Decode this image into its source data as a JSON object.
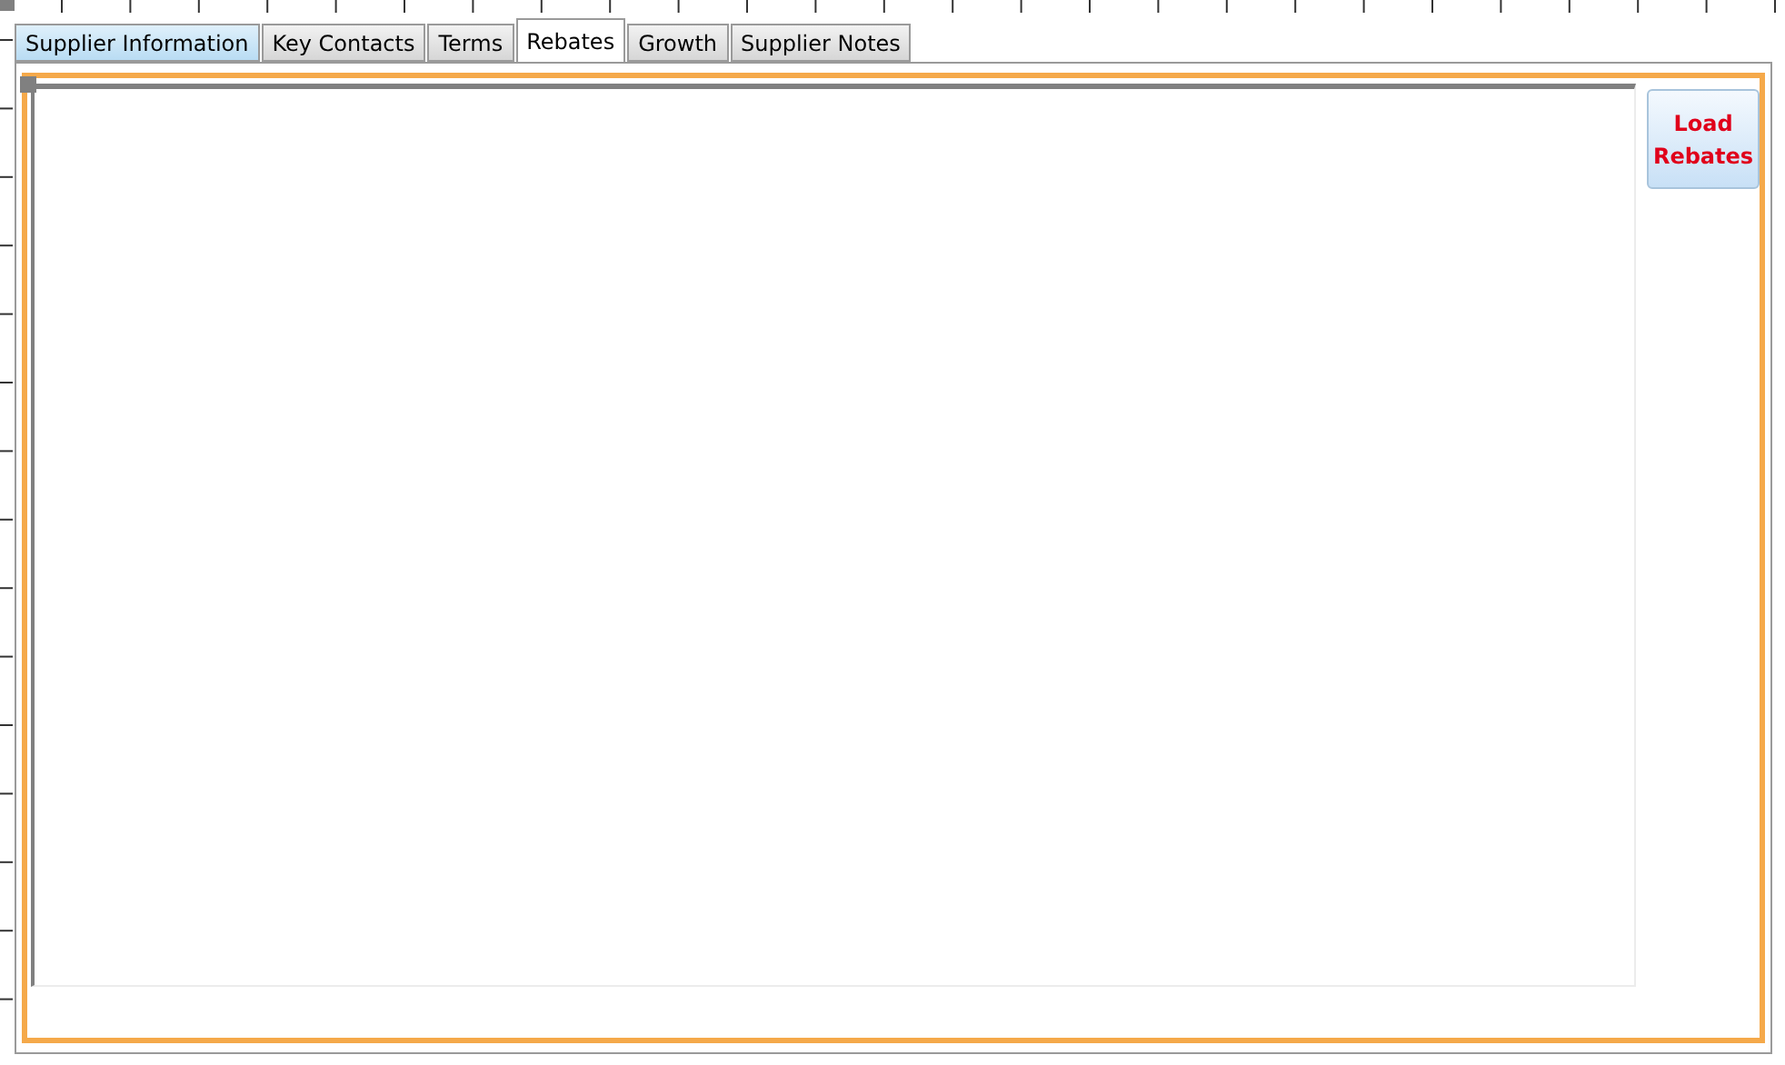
{
  "tabs": [
    {
      "label": "Supplier Information",
      "selected": false,
      "hovered": true
    },
    {
      "label": "Key Contacts",
      "selected": false,
      "hovered": false
    },
    {
      "label": "Terms",
      "selected": false,
      "hovered": false
    },
    {
      "label": "Rebates",
      "selected": true,
      "hovered": false
    },
    {
      "label": "Growth",
      "selected": false,
      "hovered": false
    },
    {
      "label": "Supplier Notes",
      "selected": false,
      "hovered": false
    }
  ],
  "button": {
    "label": "Load Rebates"
  }
}
